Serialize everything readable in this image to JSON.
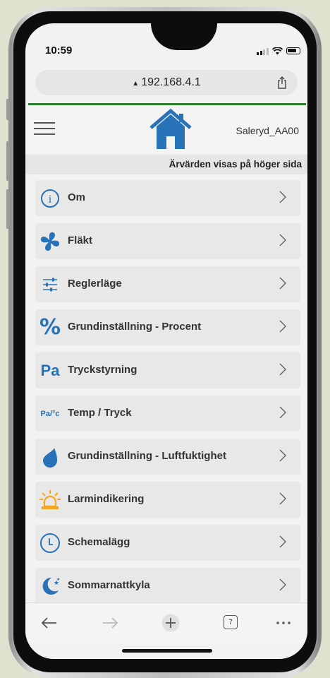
{
  "status": {
    "time": "10:59"
  },
  "browser": {
    "url": "192.168.4.1",
    "tabs_count": "7"
  },
  "header": {
    "device_name": "Saleryd_AA00",
    "note": "Ärvärden visas på höger sida"
  },
  "menu": {
    "items": [
      {
        "label": "Om",
        "icon": "info-icon"
      },
      {
        "label": "Fläkt",
        "icon": "fan-icon"
      },
      {
        "label": "Reglerläge",
        "icon": "sliders-icon"
      },
      {
        "label": "Grundinställning - Procent",
        "icon": "percent-icon",
        "glyph": "%"
      },
      {
        "label": "Tryckstyrning",
        "icon": "pressure-icon",
        "glyph": "Pa"
      },
      {
        "label": "Temp / Tryck",
        "icon": "temp-pressure-icon",
        "glyph": "Pa/°c"
      },
      {
        "label": "Grundinställning - Luftfuktighet",
        "icon": "droplet-icon"
      },
      {
        "label": "Larmindikering",
        "icon": "alarm-light-icon"
      },
      {
        "label": "Schemalägg",
        "icon": "clock-icon"
      },
      {
        "label": "Sommarnattkyla",
        "icon": "moon-stars-icon"
      }
    ]
  },
  "colors": {
    "accent_blue": "#2872b8",
    "top_line_green": "#2e7d32",
    "alarm_orange": "#f5a623"
  }
}
